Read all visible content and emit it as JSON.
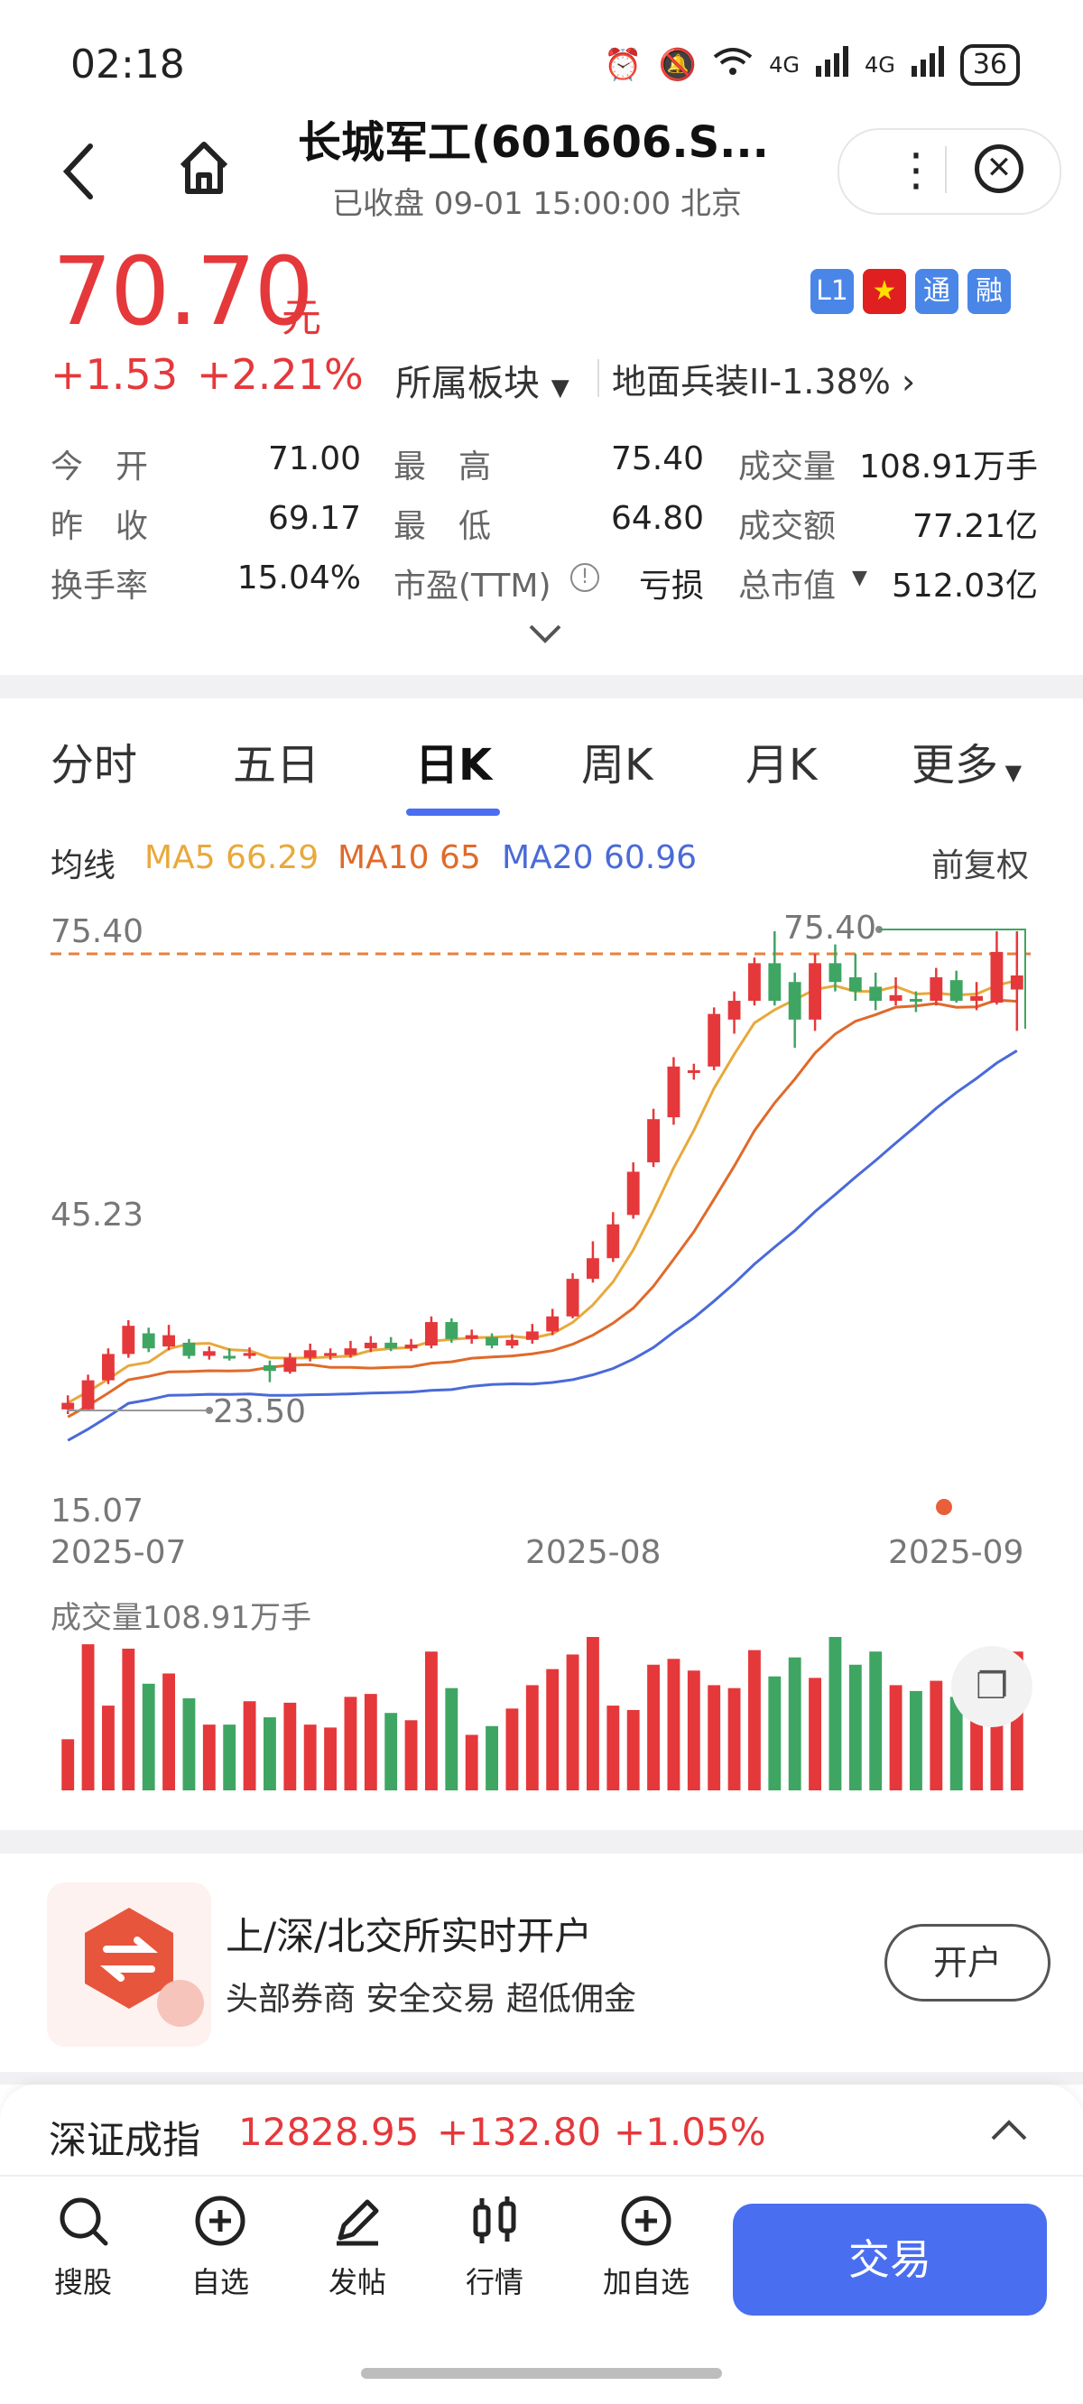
{
  "status_bar": {
    "time": "02:18",
    "battery": "36",
    "net1": "4G",
    "net2": "4G"
  },
  "header": {
    "title": "长城军工(601606.S...",
    "subtitle": "已收盘 09-01 15:00:00 北京"
  },
  "quote": {
    "price": "70.70",
    "unit": "元",
    "change": "+1.53",
    "change_pct": "+2.21%",
    "badges": [
      "L1",
      "★",
      "通",
      "融"
    ],
    "sector_label": "所属板块",
    "industry": "地面兵装II-1.38%",
    "stats": [
      {
        "label": "今　开",
        "value": "71.00",
        "color": "red"
      },
      {
        "label": "最　高",
        "value": "75.40",
        "color": "red"
      },
      {
        "label": "成交量",
        "value": "108.91万手",
        "color": "dark"
      },
      {
        "label": "昨　收",
        "value": "69.17",
        "color": "dark"
      },
      {
        "label": "最　低",
        "value": "64.80",
        "color": "green"
      },
      {
        "label": "成交额",
        "value": "77.21亿",
        "color": "dark"
      },
      {
        "label": "换手率",
        "value": "15.04%",
        "color": "dark"
      },
      {
        "label": "市盈(TTM)",
        "value": "亏损",
        "color": "dark"
      },
      {
        "label": "总市值",
        "value": "512.03亿",
        "color": "dark"
      }
    ]
  },
  "tabs": [
    "分时",
    "五日",
    "日K",
    "周K",
    "月K",
    "更多"
  ],
  "active_tab": "日K",
  "ma_bar": {
    "label": "均线",
    "ma5": "MA5 66.29",
    "ma10": "MA10 65",
    "ma20": "MA20 60.96",
    "adjust": "前复权"
  },
  "chart_data": {
    "type": "candlestick",
    "y_axis_labels": [
      "75.40",
      "45.23",
      "15.07"
    ],
    "x_axis_labels": [
      "2025-07",
      "2025-08",
      "2025-09"
    ],
    "ylim": [
      15.07,
      75.4
    ],
    "high_marker": "75.40",
    "low_marker": "23.50",
    "volume_label": "成交量108.91万手",
    "colors": {
      "up": "#e5383b",
      "down": "#3fa563",
      "ma5": "#e8a93b",
      "ma10": "#e06a2a",
      "ma20": "#4a6ad8"
    },
    "candles": [
      {
        "o": 24.5,
        "c": 25.2,
        "h": 26.0,
        "l": 24.0,
        "v": 35
      },
      {
        "o": 24.5,
        "c": 27.6,
        "h": 28.2,
        "l": 24.3,
        "v": 100
      },
      {
        "o": 27.6,
        "c": 30.4,
        "h": 31.0,
        "l": 27.2,
        "v": 58
      },
      {
        "o": 30.4,
        "c": 33.4,
        "h": 34.0,
        "l": 30.0,
        "v": 97
      },
      {
        "o": 32.6,
        "c": 31.0,
        "h": 33.2,
        "l": 30.6,
        "v": 73
      },
      {
        "o": 31.2,
        "c": 32.4,
        "h": 33.5,
        "l": 30.8,
        "v": 80
      },
      {
        "o": 31.6,
        "c": 30.2,
        "h": 32.0,
        "l": 29.9,
        "v": 63
      },
      {
        "o": 30.2,
        "c": 30.7,
        "h": 31.2,
        "l": 29.8,
        "v": 45
      },
      {
        "o": 30.2,
        "c": 30.0,
        "h": 31.0,
        "l": 29.7,
        "v": 45
      },
      {
        "o": 30.2,
        "c": 30.5,
        "h": 31.1,
        "l": 29.9,
        "v": 61
      },
      {
        "o": 29.2,
        "c": 28.6,
        "h": 29.7,
        "l": 27.4,
        "v": 50
      },
      {
        "o": 28.5,
        "c": 30.0,
        "h": 30.5,
        "l": 28.3,
        "v": 60
      },
      {
        "o": 30.0,
        "c": 30.8,
        "h": 31.5,
        "l": 29.6,
        "v": 45
      },
      {
        "o": 30.2,
        "c": 30.5,
        "h": 31.0,
        "l": 29.8,
        "v": 43
      },
      {
        "o": 30.3,
        "c": 31.0,
        "h": 31.8,
        "l": 30.0,
        "v": 64
      },
      {
        "o": 31.0,
        "c": 31.6,
        "h": 32.3,
        "l": 30.6,
        "v": 66
      },
      {
        "o": 31.6,
        "c": 31.0,
        "h": 32.2,
        "l": 30.7,
        "v": 53
      },
      {
        "o": 31.0,
        "c": 31.4,
        "h": 32.0,
        "l": 30.7,
        "v": 48
      },
      {
        "o": 31.3,
        "c": 33.8,
        "h": 34.4,
        "l": 31.0,
        "v": 95
      },
      {
        "o": 33.8,
        "c": 32.0,
        "h": 34.2,
        "l": 31.6,
        "v": 70
      },
      {
        "o": 32.0,
        "c": 32.4,
        "h": 33.0,
        "l": 31.5,
        "v": 38
      },
      {
        "o": 32.2,
        "c": 31.3,
        "h": 32.6,
        "l": 31.0,
        "v": 44
      },
      {
        "o": 31.3,
        "c": 31.9,
        "h": 32.5,
        "l": 31.0,
        "v": 56
      },
      {
        "o": 31.9,
        "c": 32.8,
        "h": 33.6,
        "l": 31.5,
        "v": 72
      },
      {
        "o": 32.8,
        "c": 34.4,
        "h": 35.2,
        "l": 32.4,
        "v": 83
      },
      {
        "o": 34.4,
        "c": 38.4,
        "h": 39.0,
        "l": 34.2,
        "v": 93
      },
      {
        "o": 38.4,
        "c": 40.6,
        "h": 42.4,
        "l": 38.0,
        "v": 105
      },
      {
        "o": 40.6,
        "c": 44.2,
        "h": 45.5,
        "l": 40.2,
        "v": 58
      },
      {
        "o": 45.2,
        "c": 49.8,
        "h": 50.8,
        "l": 44.8,
        "v": 55
      },
      {
        "o": 50.8,
        "c": 55.4,
        "h": 56.5,
        "l": 50.3,
        "v": 86
      },
      {
        "o": 55.6,
        "c": 61.0,
        "h": 62.0,
        "l": 54.8,
        "v": 90
      },
      {
        "o": 60.4,
        "c": 60.6,
        "h": 61.3,
        "l": 59.6,
        "v": 82
      },
      {
        "o": 61.0,
        "c": 66.6,
        "h": 67.3,
        "l": 60.6,
        "v": 72
      },
      {
        "o": 66.0,
        "c": 68.0,
        "h": 69.0,
        "l": 64.5,
        "v": 70
      },
      {
        "o": 68.0,
        "c": 72.0,
        "h": 72.6,
        "l": 67.5,
        "v": 96
      },
      {
        "o": 72.0,
        "c": 68.0,
        "h": 75.4,
        "l": 67.5,
        "v": 78
      },
      {
        "o": 70.0,
        "c": 66.0,
        "h": 71.0,
        "l": 63.0,
        "v": 91
      },
      {
        "o": 66.0,
        "c": 72.0,
        "h": 73.0,
        "l": 64.8,
        "v": 77
      },
      {
        "o": 72.0,
        "c": 70.0,
        "h": 74.0,
        "l": 69.0,
        "v": 105
      },
      {
        "o": 70.5,
        "c": 69.0,
        "h": 73.0,
        "l": 68.0,
        "v": 86
      },
      {
        "o": 69.5,
        "c": 68.0,
        "h": 71.0,
        "l": 67.0,
        "v": 95
      },
      {
        "o": 68.0,
        "c": 68.6,
        "h": 70.5,
        "l": 67.5,
        "v": 72
      },
      {
        "o": 68.2,
        "c": 68.0,
        "h": 69.0,
        "l": 66.8,
        "v": 68
      },
      {
        "o": 68.0,
        "c": 70.5,
        "h": 71.5,
        "l": 67.5,
        "v": 75
      },
      {
        "o": 70.2,
        "c": 68.0,
        "h": 71.2,
        "l": 67.8,
        "v": 64
      },
      {
        "o": 68.0,
        "c": 68.5,
        "h": 70.0,
        "l": 67.0,
        "v": 58
      },
      {
        "o": 67.8,
        "c": 73.2,
        "h": 75.4,
        "l": 67.6,
        "v": 62
      },
      {
        "o": 69.2,
        "c": 70.7,
        "h": 75.4,
        "l": 64.8,
        "v": 95
      }
    ]
  },
  "promo": {
    "title": "上/深/北交所实时开户",
    "subtitle": "头部券商  安全交易  超低佣金",
    "button": "开户"
  },
  "index": {
    "name": "深证成指",
    "value": "12828.95",
    "change": "+132.80",
    "pct": "+1.05%"
  },
  "nav": [
    {
      "label": "搜股",
      "icon": "search-icon"
    },
    {
      "label": "自选",
      "icon": "plus-circle-icon"
    },
    {
      "label": "发帖",
      "icon": "pencil-icon"
    },
    {
      "label": "行情",
      "icon": "candles-icon"
    },
    {
      "label": "加自选",
      "icon": "add-circle-icon"
    }
  ],
  "trade_button": "交易"
}
